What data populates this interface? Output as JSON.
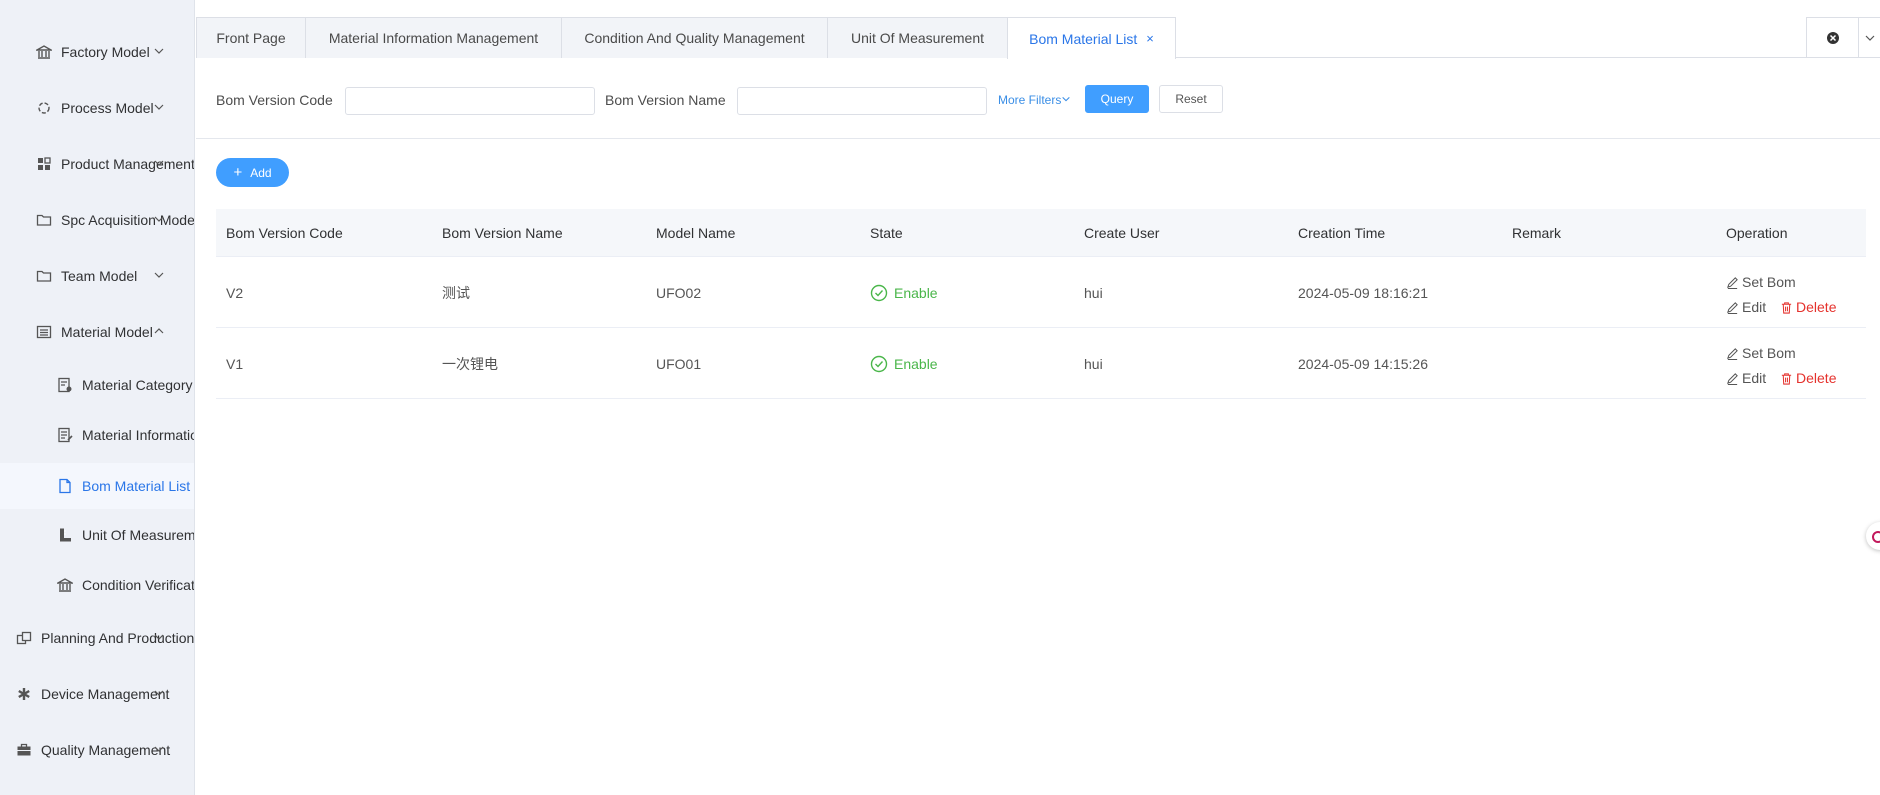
{
  "sidebar": {
    "items": [
      {
        "label": "Factory Model",
        "icon": "bank-icon",
        "chevron": "down"
      },
      {
        "label": "Process Model",
        "icon": "process-icon",
        "chevron": "down"
      },
      {
        "label": "Product Management",
        "icon": "grid-icon",
        "chevron": "down"
      },
      {
        "label": "Spc Acquisition Model",
        "icon": "folder-icon",
        "chevron": "down"
      },
      {
        "label": "Team Model",
        "icon": "folder-icon",
        "chevron": "down"
      },
      {
        "label": "Material Model",
        "icon": "list-icon",
        "chevron": "up"
      },
      {
        "label": "Material Category",
        "icon": "category-icon"
      },
      {
        "label": "Material Information",
        "icon": "info-icon"
      },
      {
        "label": "Bom Material List",
        "icon": "document-icon",
        "active": true
      },
      {
        "label": "Unit Of Measurement",
        "icon": "ruler-icon"
      },
      {
        "label": "Condition Verification",
        "icon": "bank-icon"
      },
      {
        "label": "Planning And Production",
        "icon": "windows-icon",
        "chevron": "down"
      },
      {
        "label": "Device Management",
        "icon": "asterisk-icon",
        "chevron": "down"
      },
      {
        "label": "Quality Management",
        "icon": "briefcase-icon",
        "chevron": "down"
      }
    ]
  },
  "tabs": [
    {
      "label": "Front Page"
    },
    {
      "label": "Material Information Management"
    },
    {
      "label": "Condition And Quality Management"
    },
    {
      "label": "Unit Of Measurement"
    },
    {
      "label": "Bom Material List",
      "active": true,
      "close": "×"
    }
  ],
  "filters": {
    "code_label": "Bom Version Code",
    "code_value": "",
    "name_label": "Bom Version Name",
    "name_value": "",
    "more_filters": "More Filters",
    "query": "Query",
    "reset": "Reset"
  },
  "toolbar": {
    "add_label": "Add"
  },
  "table": {
    "columns": [
      "Bom Version Code",
      "Bom Version Name",
      "Model Name",
      "State",
      "Create User",
      "Creation Time",
      "Remark",
      "Operation"
    ],
    "rows": [
      {
        "code": "V2",
        "name": "测试",
        "model": "UFO02",
        "state": "Enable",
        "user": "hui",
        "time": "2024-05-09 18:16:21",
        "remark": "",
        "set_bom": "Set Bom",
        "edit": "Edit",
        "delete": "Delete"
      },
      {
        "code": "V1",
        "name": "一次锂电",
        "model": "UFO01",
        "state": "Enable",
        "user": "hui",
        "time": "2024-05-09 14:15:26",
        "remark": "",
        "set_bom": "Set Bom",
        "edit": "Edit",
        "delete": "Delete"
      }
    ]
  },
  "colors": {
    "primary": "#409eff",
    "active_text": "#2a76e8",
    "success": "#4ab64a",
    "danger": "#e5322d"
  }
}
